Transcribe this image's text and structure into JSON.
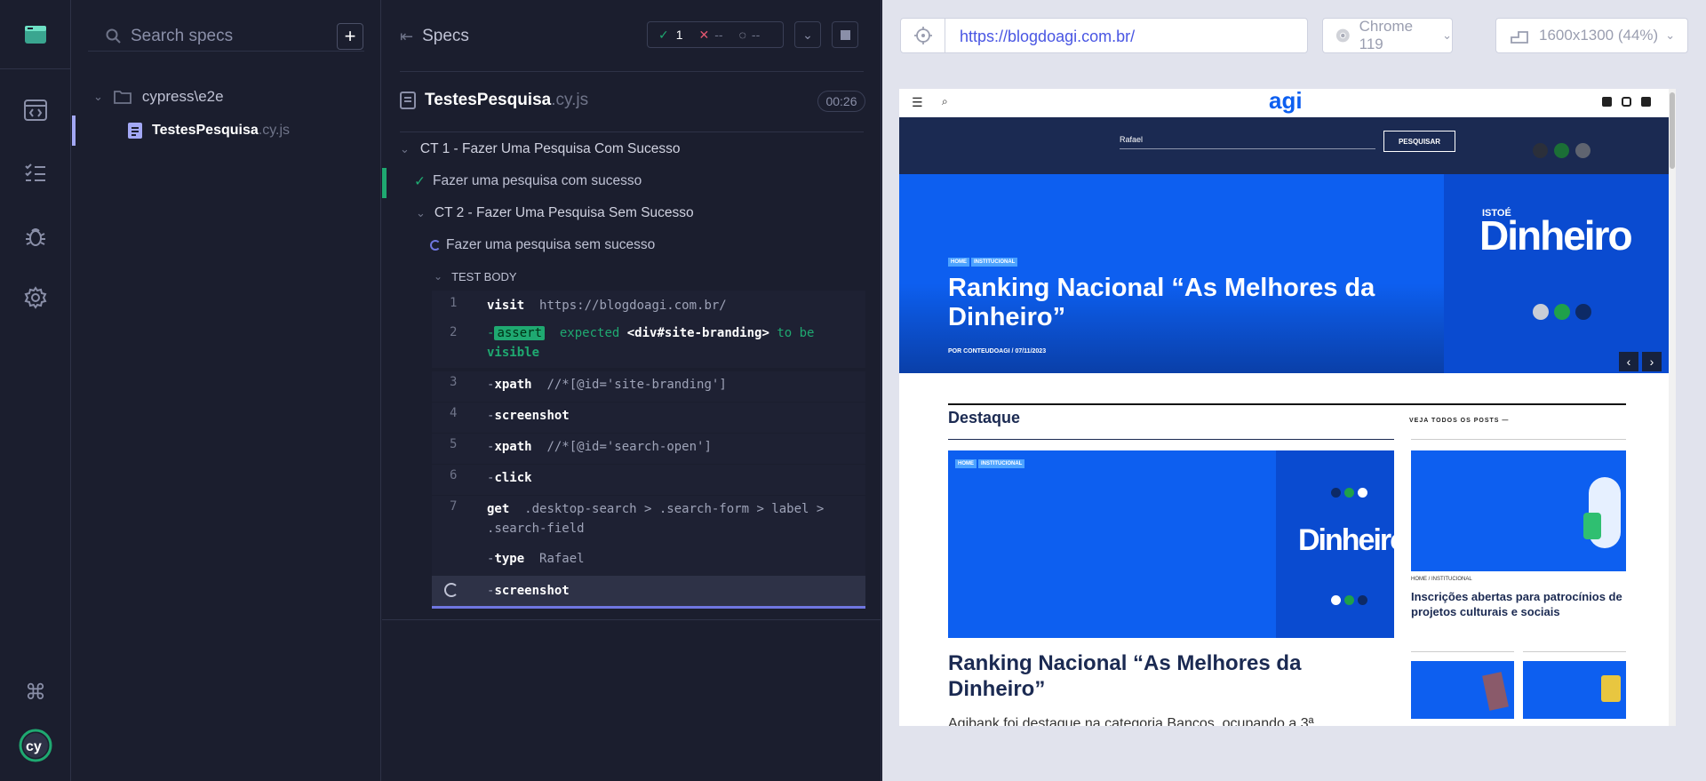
{
  "nav": {
    "items": [
      "specs",
      "runs",
      "debug",
      "settings"
    ],
    "accent": "#a3a8f5"
  },
  "specs_panel": {
    "search_placeholder": "Search specs",
    "folder": "cypress\\e2e",
    "spec_name": "TestesPesquisa",
    "spec_ext": ".cy.js"
  },
  "reporter": {
    "header": "Specs",
    "passed": "1",
    "failed": "--",
    "pending": "--",
    "spec_name": "TestesPesquisa",
    "spec_ext": ".cy.js",
    "duration": "00:26",
    "suite1": "CT 1 - Fazer Uma Pesquisa Com Sucesso",
    "test1": "Fazer uma pesquisa com sucesso",
    "suite2": "CT 2 - Fazer Uma Pesquisa Sem Sucesso",
    "test2": "Fazer uma pesquisa sem sucesso",
    "body_label": "TEST BODY",
    "commands": [
      {
        "num": "1",
        "name": "visit",
        "arg": "https://blogdoagi.com.br/"
      },
      {
        "num": "2",
        "name": "assert",
        "pre": "expected",
        "arg": "<div#site-branding>",
        "post": "to be",
        "post2": "visible"
      },
      {
        "num": "3",
        "name": "xpath",
        "arg": "//*[@id='site-branding']"
      },
      {
        "num": "4",
        "name": "screenshot",
        "arg": ""
      },
      {
        "num": "5",
        "name": "xpath",
        "arg": "//*[@id='search-open']"
      },
      {
        "num": "6",
        "name": "click",
        "arg": ""
      },
      {
        "num": "7",
        "name": "get",
        "arg": ".desktop-search > .search-form > label >",
        "arg2": ".search-field"
      },
      {
        "num": "",
        "name": "type",
        "arg": "Rafael"
      },
      {
        "num": "",
        "name": "screenshot",
        "arg": ""
      }
    ]
  },
  "browser": {
    "url": "https://blogdoagi.com.br/",
    "browser_name": "Chrome 119",
    "viewport": "1600x1300 (44%)"
  },
  "site": {
    "logo": "agi",
    "search_value": "Rafael",
    "search_button": "PESQUISAR",
    "hero_tags": [
      "HOME",
      "INSTITUCIONAL"
    ],
    "hero_brand_small": "ISTOÉ",
    "hero_brand": "Dinheiro",
    "hero_title": "Ranking Nacional “As Melhores da Dinheiro”",
    "hero_meta": "POR CONTEUDOAGI  /  07/11/2023",
    "section_title": "Destaque",
    "section_link": "VEJA TODOS OS POSTS —",
    "card_tags": [
      "HOME",
      "INSTITUCIONAL"
    ],
    "card_title": "Ranking Nacional “As Melhores da Dinheiro”",
    "card_excerpt": "Agibank foi destaque na categoria Bancos, ocupando a 3ª",
    "side_meta": "HOME  /  INSTITUCIONAL",
    "side_title": "Inscrições abertas para patrocínios de projetos culturais e sociais"
  }
}
